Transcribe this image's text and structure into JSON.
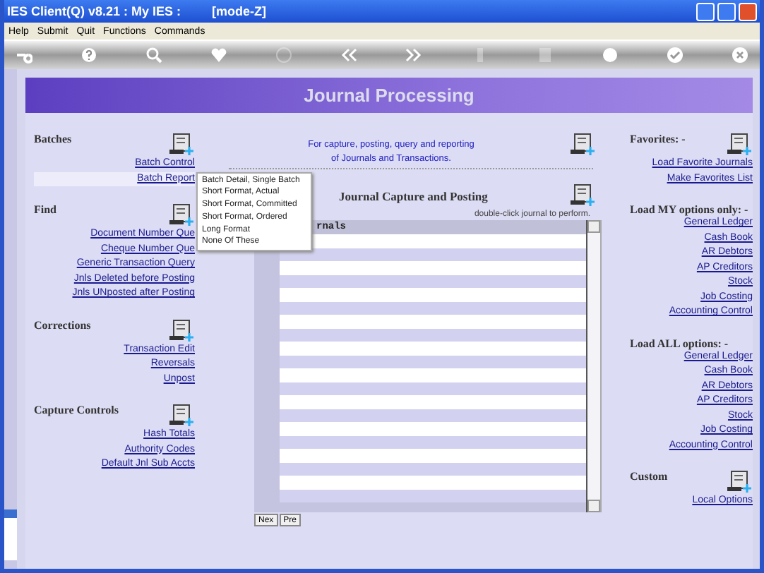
{
  "window": {
    "title": "IES Client(Q) v8.21 : My IES :",
    "mode": "[mode-Z]"
  },
  "menu": [
    "Help",
    "Submit",
    "Quit",
    "Functions",
    "Commands"
  ],
  "page_title": "Journal Processing",
  "left_sections": [
    {
      "title": "Batches",
      "links": [
        {
          "label": "Batch Control",
          "selected": false
        },
        {
          "label": "Batch Report",
          "selected": true
        }
      ]
    },
    {
      "title": "Find",
      "links": [
        {
          "label": "Document Number Que",
          "selected": false
        },
        {
          "label": "Cheque Number Que",
          "selected": false
        },
        {
          "label": "Generic Transaction Query",
          "selected": false
        },
        {
          "label": "Jnls Deleted before Posting",
          "selected": false
        },
        {
          "label": "Jnls UNposted after Posting",
          "selected": false
        }
      ]
    },
    {
      "title": "Corrections",
      "links": [
        {
          "label": "Transaction Edit",
          "selected": false
        },
        {
          "label": "Reversals",
          "selected": false
        },
        {
          "label": "Unpost",
          "selected": false
        }
      ]
    },
    {
      "title": "Capture Controls",
      "links": [
        {
          "label": "Hash Totals",
          "selected": false
        },
        {
          "label": "Authority Codes",
          "selected": false
        },
        {
          "label": "Default Jnl Sub Accts",
          "selected": false
        }
      ]
    }
  ],
  "popup_menu": [
    "Batch Detail, Single Batch",
    "Short Format, Actual",
    "Short Format, Committed",
    "Short Format, Ordered",
    "Long Format",
    "None Of These"
  ],
  "intro": [
    "For capture, posting, query and reporting",
    "of Journals and Transactions."
  ],
  "capture_title": "Journal Capture and Posting",
  "hint": "double-click journal to perform.",
  "table": {
    "header": "rnals"
  },
  "pager": [
    "Nex",
    "Pre"
  ],
  "right_sections": [
    {
      "title": "Favorites: -",
      "icon": true,
      "links": [
        "Load Favorite Journals",
        "Make Favorites List"
      ]
    },
    {
      "title": "Load MY options only: -",
      "icon": false,
      "links": [
        "General Ledger",
        "Cash Book",
        "AR Debtors",
        "AP Creditors",
        "Stock",
        "Job Costing",
        "Accounting Control"
      ]
    },
    {
      "title": "Load ALL options: -",
      "icon": false,
      "links": [
        "General Ledger",
        "Cash Book",
        "AR Debtors",
        "AP Creditors",
        "Stock",
        "Job Costing",
        "Accounting Control"
      ]
    },
    {
      "title": "Custom",
      "icon": true,
      "links": [
        "Local Options"
      ]
    }
  ]
}
